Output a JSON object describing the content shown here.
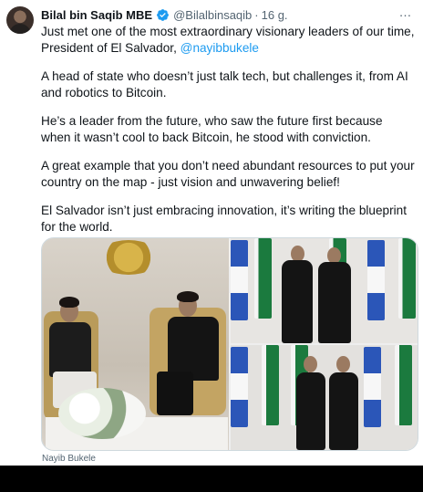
{
  "tweet": {
    "author_name": "Bilal bin Saqib MBE",
    "handle": "@Bilalbinsaqib",
    "separator": "·",
    "time": "16 g.",
    "more_icon": "…",
    "text_line1": "Just met one of the most extraordinary visionary leaders of our time,",
    "text_line2_prefix": "President of El Salvador, ",
    "mention": "@nayibbukele",
    "paragraphs": [
      "A head of state who doesn’t just talk tech, but challenges it, from AI and robotics to Bitcoin.",
      "He’s a leader from the future, who saw the future first because when it wasn’t cool to back Bitcoin, he stood with conviction.",
      "A great example that you don’t need abundant resources to put your country on the map - just vision and unwavering belief!",
      "El Salvador isn’t just embracing innovation, it’s writing the blueprint for the world."
    ],
    "media_caption": "Nayib Bukele"
  },
  "icons": {
    "verified": "verified-badge-icon",
    "more": "more-options-icon"
  },
  "colors": {
    "link": "#1d9bf0",
    "verified": "#1d9bf0",
    "muted": "#536471"
  }
}
